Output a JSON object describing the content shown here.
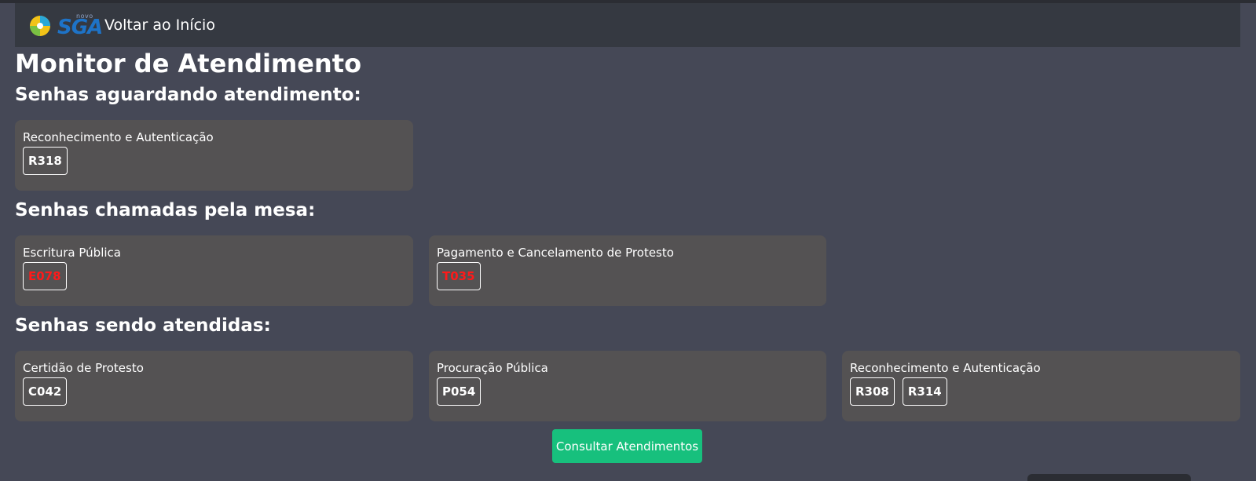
{
  "navbar": {
    "logo_small": "novo",
    "logo_text": "SGA",
    "home_link": "Voltar ao Início"
  },
  "page_title": "Monitor de Atendimento",
  "sections": {
    "waiting": {
      "title": "Senhas aguardando atendimento:",
      "cards": [
        {
          "service": "Reconhecimento e Autenticação",
          "tickets": [
            "R318"
          ]
        }
      ]
    },
    "called": {
      "title": "Senhas chamadas pela mesa:",
      "cards": [
        {
          "service": "Escritura Pública",
          "tickets": [
            "E078"
          ]
        },
        {
          "service": "Pagamento e Cancelamento de Protesto",
          "tickets": [
            "T035"
          ]
        }
      ]
    },
    "serving": {
      "title": "Senhas sendo atendidas:",
      "cards": [
        {
          "service": "Certidão de Protesto",
          "tickets": [
            "C042"
          ]
        },
        {
          "service": "Procuração Pública",
          "tickets": [
            "P054"
          ]
        },
        {
          "service": "Reconhecimento e Autenticação",
          "tickets": [
            "R308",
            "R314"
          ]
        }
      ]
    }
  },
  "consult_button": "Consultar Atendimentos",
  "colors": {
    "background": "#454856",
    "navbar": "#353941",
    "card": "#545253",
    "called_ticket": "#ff1a1a",
    "button": "#17c07d"
  }
}
